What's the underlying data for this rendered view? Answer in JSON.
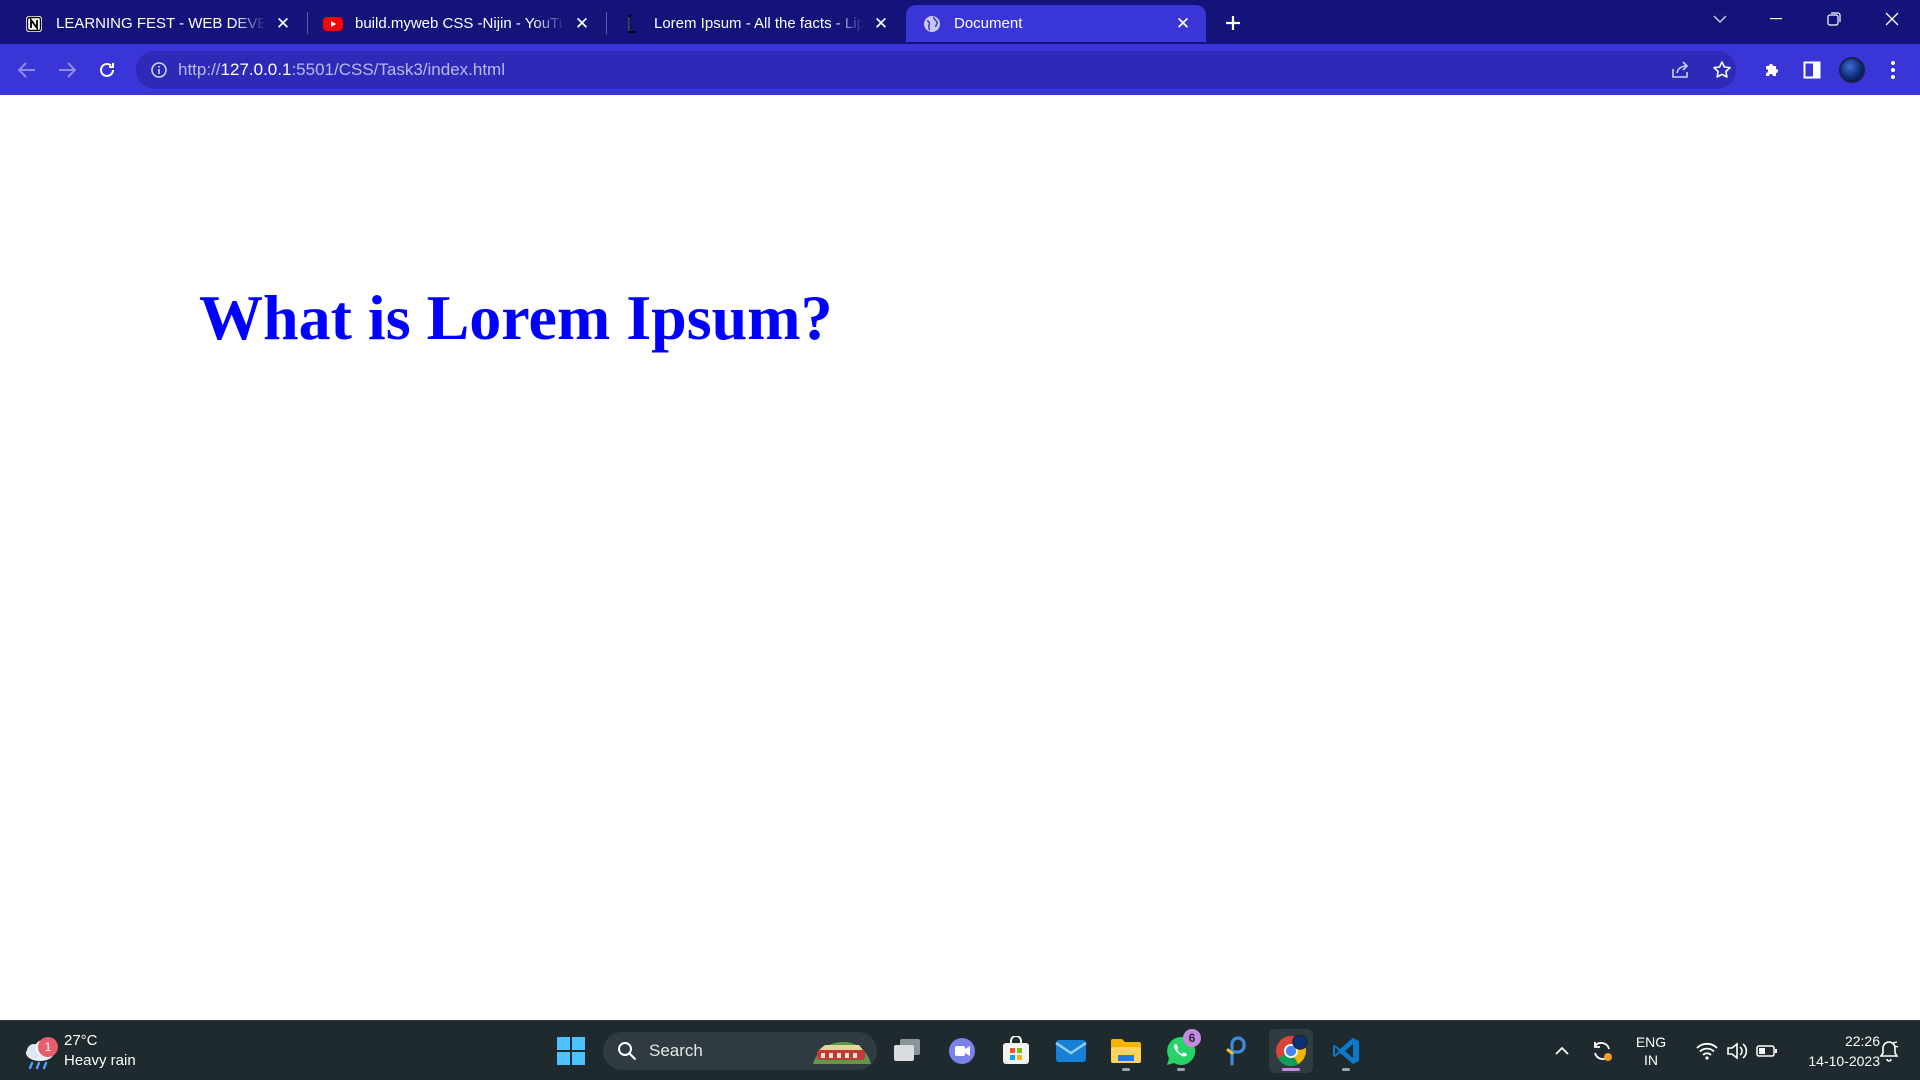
{
  "browser": {
    "tabs": [
      {
        "title": "LEARNING FEST - WEB DEVELOPMENT",
        "favicon": "notion-icon",
        "active": false
      },
      {
        "title": "build.myweb CSS -Nijin - YouTube",
        "favicon": "youtube-icon",
        "active": false
      },
      {
        "title": "Lorem Ipsum - All the facts - Lipsum",
        "favicon": "lipsum-icon",
        "active": true
      },
      {
        "title": "Document",
        "favicon": "globe-icon",
        "active": true
      }
    ],
    "url": {
      "scheme": "http://",
      "host": "127.0.0.1",
      "rest": ":5501/CSS/Task3/index.html"
    },
    "colors": {
      "tabstrip": "#14137a",
      "toolbar": "#3a35d6",
      "omnibox": "#2e2ab8"
    }
  },
  "page": {
    "heading": "What is Lorem Ipsum?",
    "heading_color": "#0000ff"
  },
  "taskbar": {
    "weather": {
      "temp": "27°C",
      "condition": "Heavy rain",
      "badge": "1"
    },
    "search_label": "Search",
    "whatsapp_badge": "6",
    "lang_top": "ENG",
    "lang_bottom": "IN",
    "time": "22:26",
    "date": "14-10-2023"
  }
}
